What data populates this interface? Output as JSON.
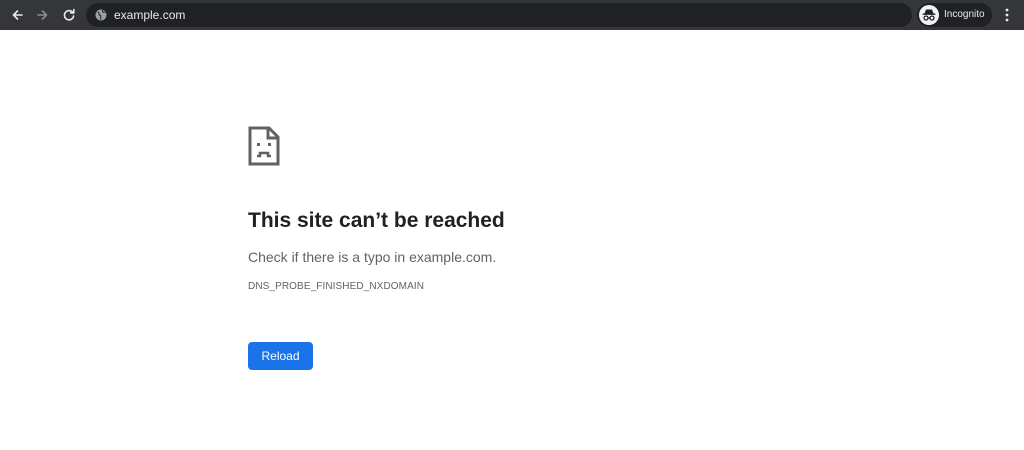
{
  "browser": {
    "url": "example.com",
    "incognito_label": "Incognito",
    "icons": {
      "back": "arrow-left",
      "forward": "arrow-right",
      "reload": "reload",
      "site": "globe",
      "incognito": "incognito-hat-glasses",
      "menu": "three-dots-vertical"
    },
    "colors": {
      "toolbar": "#35363a",
      "omnibox": "#202124",
      "text": "#e8eaed"
    }
  },
  "error_page": {
    "icon": "sad-document",
    "title": "This site can’t be reached",
    "description": "Check if there is a typo in example.com.",
    "error_code": "DNS_PROBE_FINISHED_NXDOMAIN",
    "reload_label": "Reload",
    "colors": {
      "title": "#202124",
      "body": "#5f6368",
      "button": "#1a73e8"
    }
  }
}
